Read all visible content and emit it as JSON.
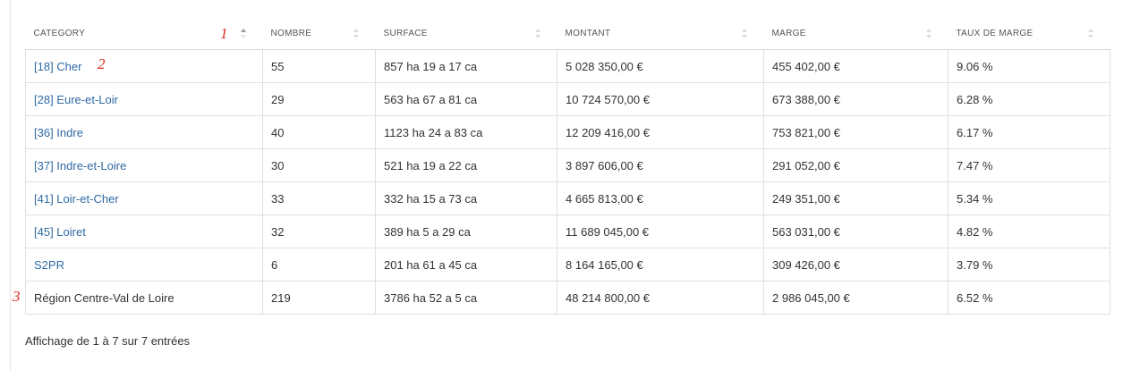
{
  "table": {
    "columns": [
      {
        "label": "CATEGORY",
        "sort_icon": "sort-asc-icon"
      },
      {
        "label": "NOMBRE",
        "sort_icon": "sort-icon"
      },
      {
        "label": "SURFACE",
        "sort_icon": "sort-icon"
      },
      {
        "label": "MONTANT",
        "sort_icon": "sort-icon"
      },
      {
        "label": "MARGE",
        "sort_icon": "sort-icon"
      },
      {
        "label": "TAUX DE MARGE",
        "sort_icon": "sort-icon"
      }
    ],
    "rows": [
      {
        "category": "[18] Cher",
        "nombre": "55",
        "surface": "857 ha 19 a 17 ca",
        "montant": "5 028 350,00 €",
        "marge": "455 402,00 €",
        "taux": "9.06 %",
        "is_link": true
      },
      {
        "category": "[28] Eure-et-Loir",
        "nombre": "29",
        "surface": "563 ha 67 a 81 ca",
        "montant": "10 724 570,00 €",
        "marge": "673 388,00 €",
        "taux": "6.28 %",
        "is_link": true
      },
      {
        "category": "[36] Indre",
        "nombre": "40",
        "surface": "1123 ha 24 a 83 ca",
        "montant": "12 209 416,00 €",
        "marge": "753 821,00 €",
        "taux": "6.17 %",
        "is_link": true
      },
      {
        "category": "[37] Indre-et-Loire",
        "nombre": "30",
        "surface": "521 ha 19 a 22 ca",
        "montant": "3 897 606,00 €",
        "marge": "291 052,00 €",
        "taux": "7.47 %",
        "is_link": true
      },
      {
        "category": "[41] Loir-et-Cher",
        "nombre": "33",
        "surface": "332 ha 15 a 73 ca",
        "montant": "4 665 813,00 €",
        "marge": "249 351,00 €",
        "taux": "5.34 %",
        "is_link": true
      },
      {
        "category": "[45] Loiret",
        "nombre": "32",
        "surface": "389 ha 5 a 29 ca",
        "montant": "11 689 045,00 €",
        "marge": "563 031,00 €",
        "taux": "4.82 %",
        "is_link": true
      },
      {
        "category": "S2PR",
        "nombre": "6",
        "surface": "201 ha 61 a 45 ca",
        "montant": "8 164 165,00 €",
        "marge": "309 426,00 €",
        "taux": "3.79 %",
        "is_link": true
      },
      {
        "category": "Région Centre-Val de Loire",
        "nombre": "219",
        "surface": "3786 ha 52 a 5 ca",
        "montant": "48 214 800,00 €",
        "marge": "2 986 045,00 €",
        "taux": "6.52 %",
        "is_link": false
      }
    ]
  },
  "info_text": "Affichage de 1 à 7 sur 7 entrées",
  "annotations": [
    "1",
    "2",
    "3"
  ],
  "colors": {
    "link": "#2f6aa3",
    "annotation": "#e0281e",
    "border": "#e0e0e0"
  }
}
